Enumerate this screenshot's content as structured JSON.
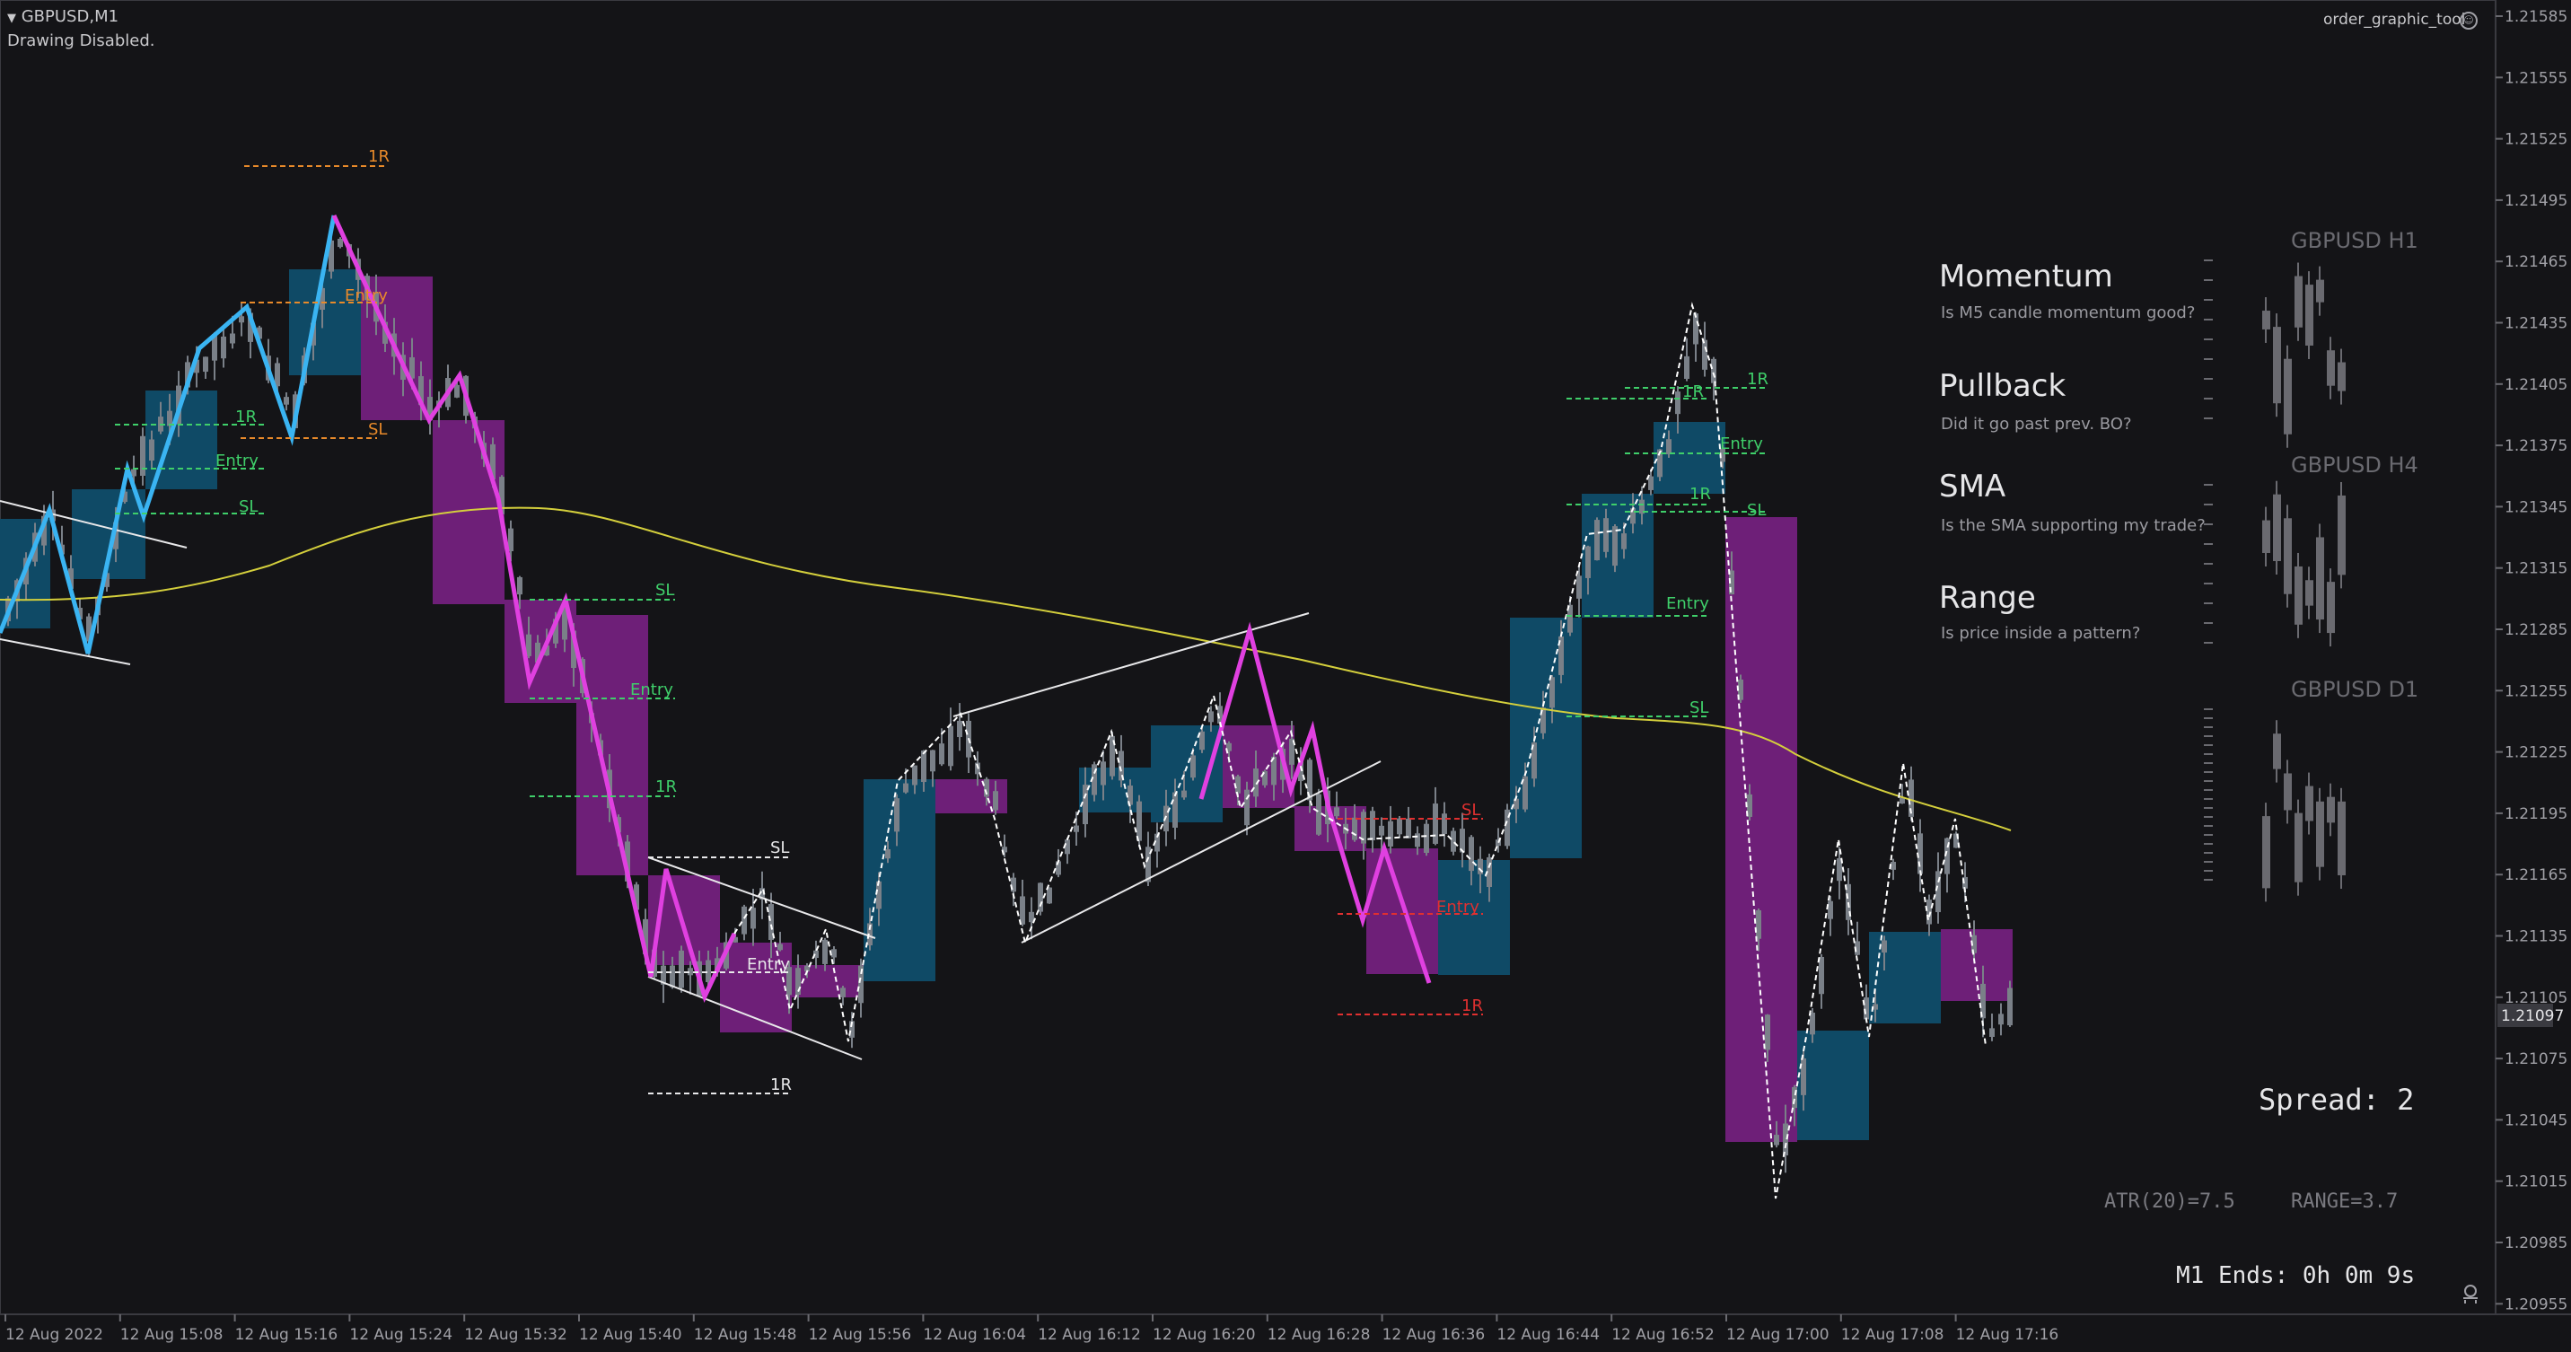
{
  "header": {
    "symbol": "GBPUSD,M1",
    "status": "Drawing Disabled."
  },
  "tool": {
    "name": "order_graphic_tool"
  },
  "price_axis": {
    "labels": [
      "1.21585",
      "1.21555",
      "1.21525",
      "1.21495",
      "1.21465",
      "1.21435",
      "1.21405",
      "1.21375",
      "1.21345",
      "1.21315",
      "1.21285",
      "1.21255",
      "1.21225",
      "1.21195",
      "1.21165",
      "1.21135",
      "1.21105",
      "1.21075",
      "1.21045",
      "1.21015",
      "1.20985",
      "1.20955"
    ],
    "current": "1.21097"
  },
  "time_axis": {
    "labels": [
      "12 Aug 2022",
      "12 Aug 15:08",
      "12 Aug 15:16",
      "12 Aug 15:24",
      "12 Aug 15:32",
      "12 Aug 15:40",
      "12 Aug 15:48",
      "12 Aug 15:56",
      "12 Aug 16:04",
      "12 Aug 16:12",
      "12 Aug 16:20",
      "12 Aug 16:28",
      "12 Aug 16:36",
      "12 Aug 16:44",
      "12 Aug 16:52",
      "12 Aug 17:00",
      "12 Aug 17:08",
      "12 Aug 17:16"
    ]
  },
  "checklist": [
    {
      "title": "Momentum",
      "question": "Is M5 candle momentum good?"
    },
    {
      "title": "Pullback",
      "question": "Did it go past prev. BO?"
    },
    {
      "title": "SMA",
      "question": "Is the SMA supporting my trade?"
    },
    {
      "title": "Range",
      "question": "Is price inside a pattern?"
    }
  ],
  "mini_charts": [
    {
      "title": "GBPUSD H1"
    },
    {
      "title": "GBPUSD H4"
    },
    {
      "title": "GBPUSD D1"
    }
  ],
  "stats": {
    "spread": "Spread: 2",
    "atr": "ATR(20)=7.5",
    "range": "RANGE=3.7",
    "timer": "M1 Ends: 0h 0m 9s"
  },
  "levels": {
    "one_r": "1R",
    "entry": "Entry",
    "sl": "SL"
  },
  "colors": {
    "background": "#141417",
    "bull_box": "#0f4a66",
    "bear_box": "#6e1f78",
    "sma": "#d4cf3c",
    "zigzag_up": "#3ab4f2",
    "zigzag_down": "#e040e0",
    "level_green": "#3fcf6a",
    "level_orange": "#e88a2a",
    "level_red": "#e03030",
    "candle": "#7a8088"
  }
}
